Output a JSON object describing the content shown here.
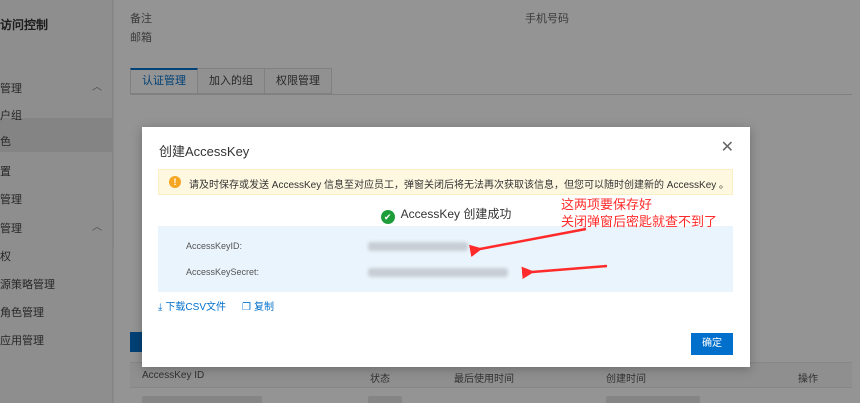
{
  "sidebar": {
    "title": "访问控制",
    "items": [
      "管理",
      "户组",
      "色",
      "置",
      "管理",
      "管理",
      "权",
      "源策略管理",
      "角色管理",
      "应用管理"
    ]
  },
  "main": {
    "labels": {
      "remark": "备注",
      "phone": "手机号码",
      "email": "邮箱"
    },
    "tabs": [
      "认证管理",
      "加入的组",
      "权限管理"
    ],
    "table": {
      "headers": [
        "AccessKey ID",
        "状态",
        "最后使用时间",
        "创建时间",
        "操作"
      ]
    }
  },
  "modal": {
    "title": "创建AccessKey",
    "close_icon": "close-icon",
    "warning": "请及时保存或发送 AccessKey 信息至对应员工，弹窗关闭后将无法再次获取该信息，但您可以随时创建新的 AccessKey 。",
    "success": "AccessKey 创建成功",
    "key_id_label": "AccessKeyID:",
    "key_secret_label": "AccessKeySecret:",
    "download_label": "下载CSV文件",
    "copy_label": "复制",
    "ok_label": "确定"
  },
  "annotation": {
    "line1": "这两项要保存好",
    "line2": "关闭弹窗后密匙就查不到了",
    "color": "#ff2a2a"
  },
  "colors": {
    "primary": "#0070cc",
    "warning_bg": "#fff8e1",
    "success": "#1e9e3a"
  }
}
